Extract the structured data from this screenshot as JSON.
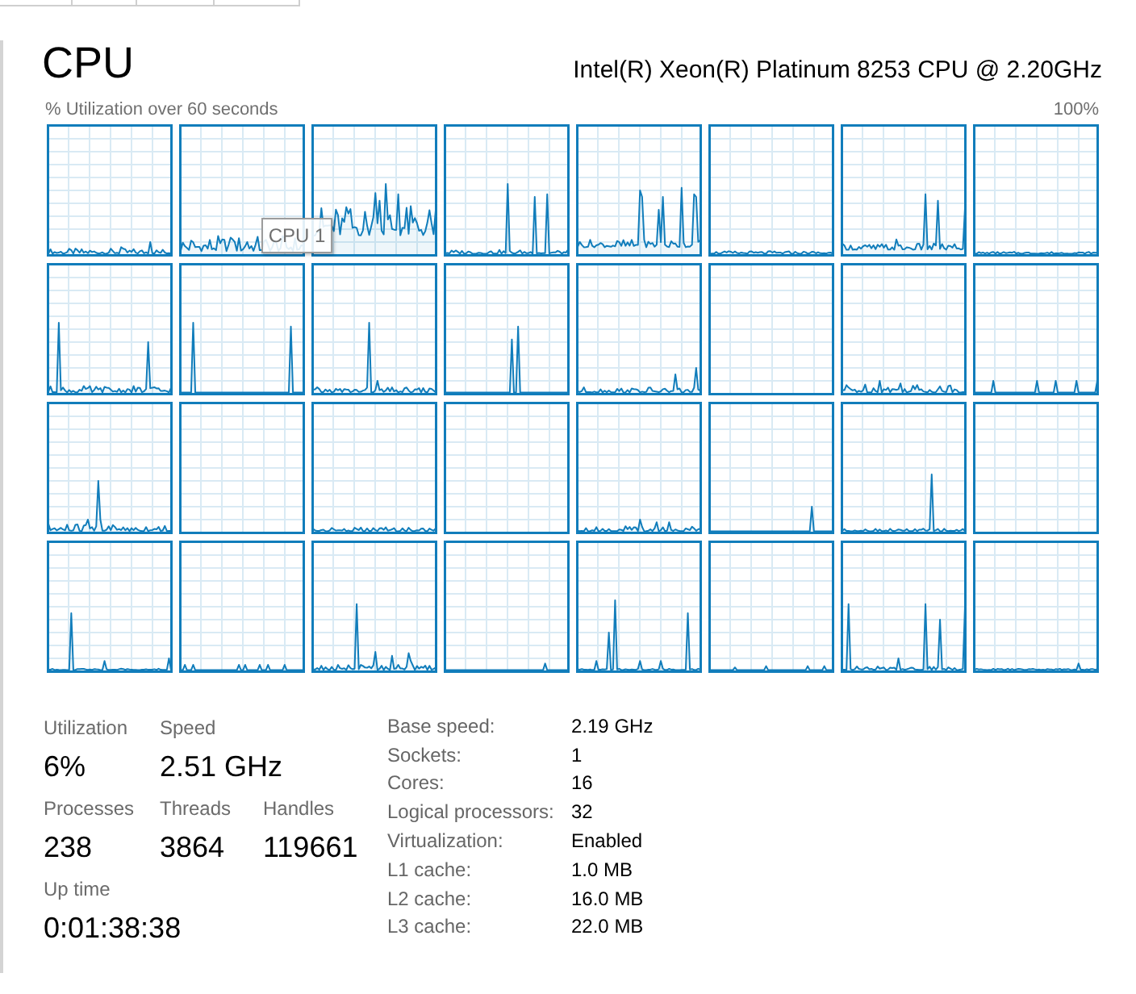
{
  "header": {
    "title": "CPU",
    "processor": "Intel(R) Xeon(R) Platinum 8253 CPU @ 2.20GHz"
  },
  "graph_area": {
    "caption": "% Utilization over 60 seconds",
    "max_label": "100%",
    "tooltip": "CPU 1"
  },
  "stat_rows": [
    {
      "items": [
        {
          "label": "Utilization",
          "value": "6%"
        },
        {
          "label": "Speed",
          "value": "2.51 GHz"
        }
      ]
    },
    {
      "items": [
        {
          "label": "Processes",
          "value": "238"
        },
        {
          "label": "Threads",
          "value": "3864"
        },
        {
          "label": "Handles",
          "value": "119661"
        }
      ]
    },
    {
      "items": [
        {
          "label": "Up time",
          "value": "0:01:38:38"
        }
      ]
    }
  ],
  "details": [
    {
      "label": "Base speed:",
      "value": "2.19 GHz"
    },
    {
      "label": "Sockets:",
      "value": "1"
    },
    {
      "label": "Cores:",
      "value": "16"
    },
    {
      "label": "Logical processors:",
      "value": "32"
    },
    {
      "label": "Virtualization:",
      "value": "Enabled"
    },
    {
      "label": "L1 cache:",
      "value": "1.0 MB"
    },
    {
      "label": "L2 cache:",
      "value": "16.0 MB"
    },
    {
      "label": "L3 cache:",
      "value": "22.0 MB"
    }
  ]
}
